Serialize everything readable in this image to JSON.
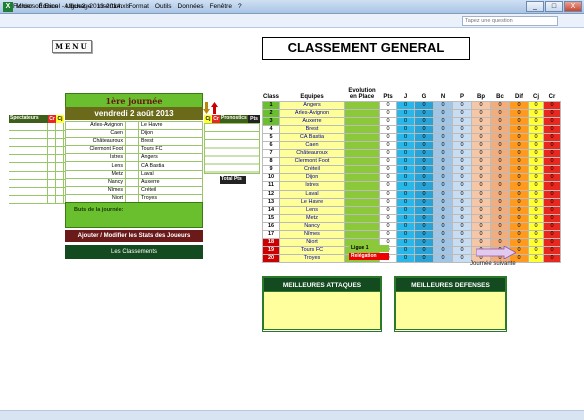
{
  "window": {
    "title": "Microsoft Excel - Ligue2- 2013-2014.xls",
    "ask_placeholder": "Tapez une question",
    "minimize": "_",
    "maximize": "□",
    "close": "X"
  },
  "menu": [
    "Fichier",
    "Édition",
    "Affichage",
    "Insertion",
    "Format",
    "Outils",
    "Données",
    "Fenêtre",
    "?"
  ],
  "menu_button": "MENU",
  "main_title": "CLASSEMENT GENERAL",
  "journee": {
    "label": "1ère journée",
    "date": "vendredi 2 août 2013"
  },
  "side_headers": {
    "spectateurs": "Spectateurs",
    "cr": "Cr",
    "cj": "Cj",
    "pronostics": "Pronostics",
    "pts": "Pts",
    "total_pts": "Total Pts"
  },
  "matches": [
    {
      "home": "Arles-Avignon",
      "away": "Le Havre"
    },
    {
      "home": "Caen",
      "away": "Dijon"
    },
    {
      "home": "Châteauroux",
      "away": "Brest"
    },
    {
      "home": "Clermont Foot",
      "away": "Tours FC"
    },
    {
      "home": "Istres",
      "away": "Angers"
    },
    {
      "home": "Lens",
      "away": "CA Bastia"
    },
    {
      "home": "Metz",
      "away": "Laval"
    },
    {
      "home": "Nancy",
      "away": "Auxerre"
    },
    {
      "home": "Nîmes",
      "away": "Créteil"
    },
    {
      "home": "Niort",
      "away": "Troyes"
    }
  ],
  "buts_label": "Buts de la journée:",
  "stats_button": "Ajouter / Modifier les Stats des Joueurs",
  "classements_button": "Les Classements",
  "standings_headers": {
    "class": "Class",
    "team": "Equipes",
    "evo": "Evolution en Place",
    "pts": "Pts",
    "j": "J",
    "g": "G",
    "n": "N",
    "p": "P",
    "bp": "Bp",
    "bc": "Bc",
    "dif": "Dif",
    "cj": "Cj",
    "cr": "Cr"
  },
  "standings": [
    {
      "rank": "1",
      "team": "Angers"
    },
    {
      "rank": "2",
      "team": "Arles-Avignon"
    },
    {
      "rank": "3",
      "team": "Auxerre"
    },
    {
      "rank": "4",
      "team": "Brest"
    },
    {
      "rank": "5",
      "team": "CA Bastia"
    },
    {
      "rank": "6",
      "team": "Caen"
    },
    {
      "rank": "7",
      "team": "Châteauroux"
    },
    {
      "rank": "8",
      "team": "Clermont Foot"
    },
    {
      "rank": "9",
      "team": "Créteil"
    },
    {
      "rank": "10",
      "team": "Dijon"
    },
    {
      "rank": "11",
      "team": "Istres"
    },
    {
      "rank": "12",
      "team": "Laval"
    },
    {
      "rank": "13",
      "team": "Le Havre"
    },
    {
      "rank": "14",
      "team": "Lens"
    },
    {
      "rank": "15",
      "team": "Metz"
    },
    {
      "rank": "16",
      "team": "Nancy"
    },
    {
      "rank": "17",
      "team": "Nîmes"
    },
    {
      "rank": "18",
      "team": "Niort"
    },
    {
      "rank": "19",
      "team": "Tours FC"
    },
    {
      "rank": "20",
      "team": "Troyes"
    }
  ],
  "stat_zero": "0",
  "legend": {
    "ligue1": "Ligue 1",
    "relegation": "Relégation"
  },
  "next_label": "Journée suivante",
  "attaques_title": "MEILLEURES ATTAQUES",
  "defenses_title": "MEILLEURES DEFENSES",
  "colors": {
    "green": "#6abf2e",
    "dark_green": "#134a1f",
    "maroon": "#6b1a1a",
    "relegation": "#e00",
    "rank_relegation": "#c00"
  }
}
